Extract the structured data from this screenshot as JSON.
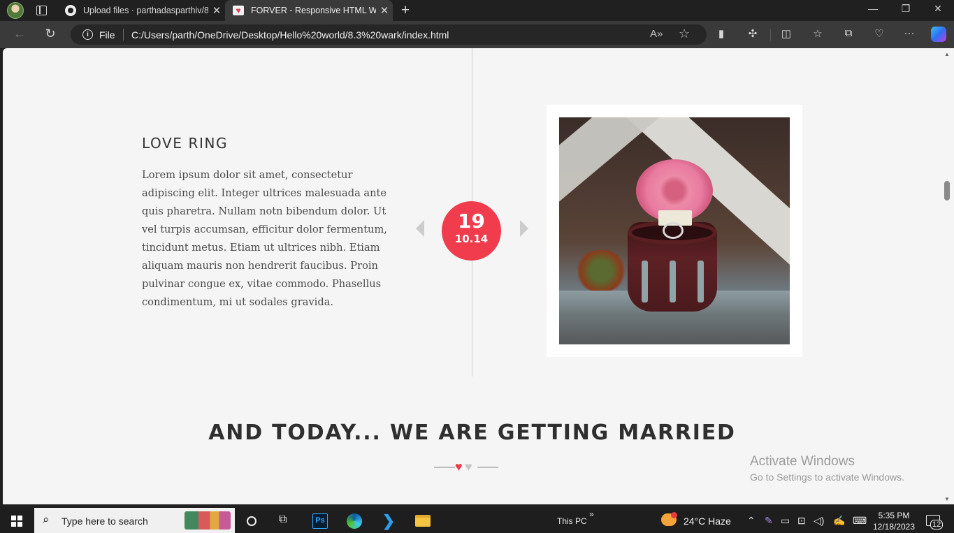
{
  "browser": {
    "tabs": [
      {
        "title": "Upload files · parthadasparthiv/8",
        "favicon": "github-icon"
      },
      {
        "title": "FORVER - Responsive HTML Wed",
        "favicon": "heart-icon",
        "active": true
      }
    ],
    "address": {
      "scheme_label": "File",
      "url": "C:/Users/parth/OneDrive/Desktop/Hello%20world/8.3%20wark/index.html"
    }
  },
  "page": {
    "event": {
      "title": "LOVE RING",
      "text": "Lorem ipsum dolor sit amet, consectetur adipiscing elit. Integer ultrices malesuada ante quis pharetra. Nullam notn bibendum dolor. Ut vel turpis accumsan, efficitur dolor fermentum, tincidunt metus. Etiam ut ultrices nibh. Etiam aliquam mauris non hendrerit faucibus. Proin pulvinar congue ex, vitae commodo. Phasellus condimentum, mi ut sodales gravida.",
      "date_day": "19",
      "date_month_year": "10.14"
    },
    "section_title": "AND TODAY... WE ARE GETTING MARRIED",
    "accent_color": "#f03c4c",
    "watermark": {
      "line1": "Activate Windows",
      "line2": "Go to Settings to activate Windows."
    }
  },
  "taskbar": {
    "search_placeholder": "Type here to search",
    "toolbar_label": "This PC",
    "weather": "24°C  Haze",
    "time": "5:35 PM",
    "date": "12/18/2023",
    "notification_count": "12"
  }
}
